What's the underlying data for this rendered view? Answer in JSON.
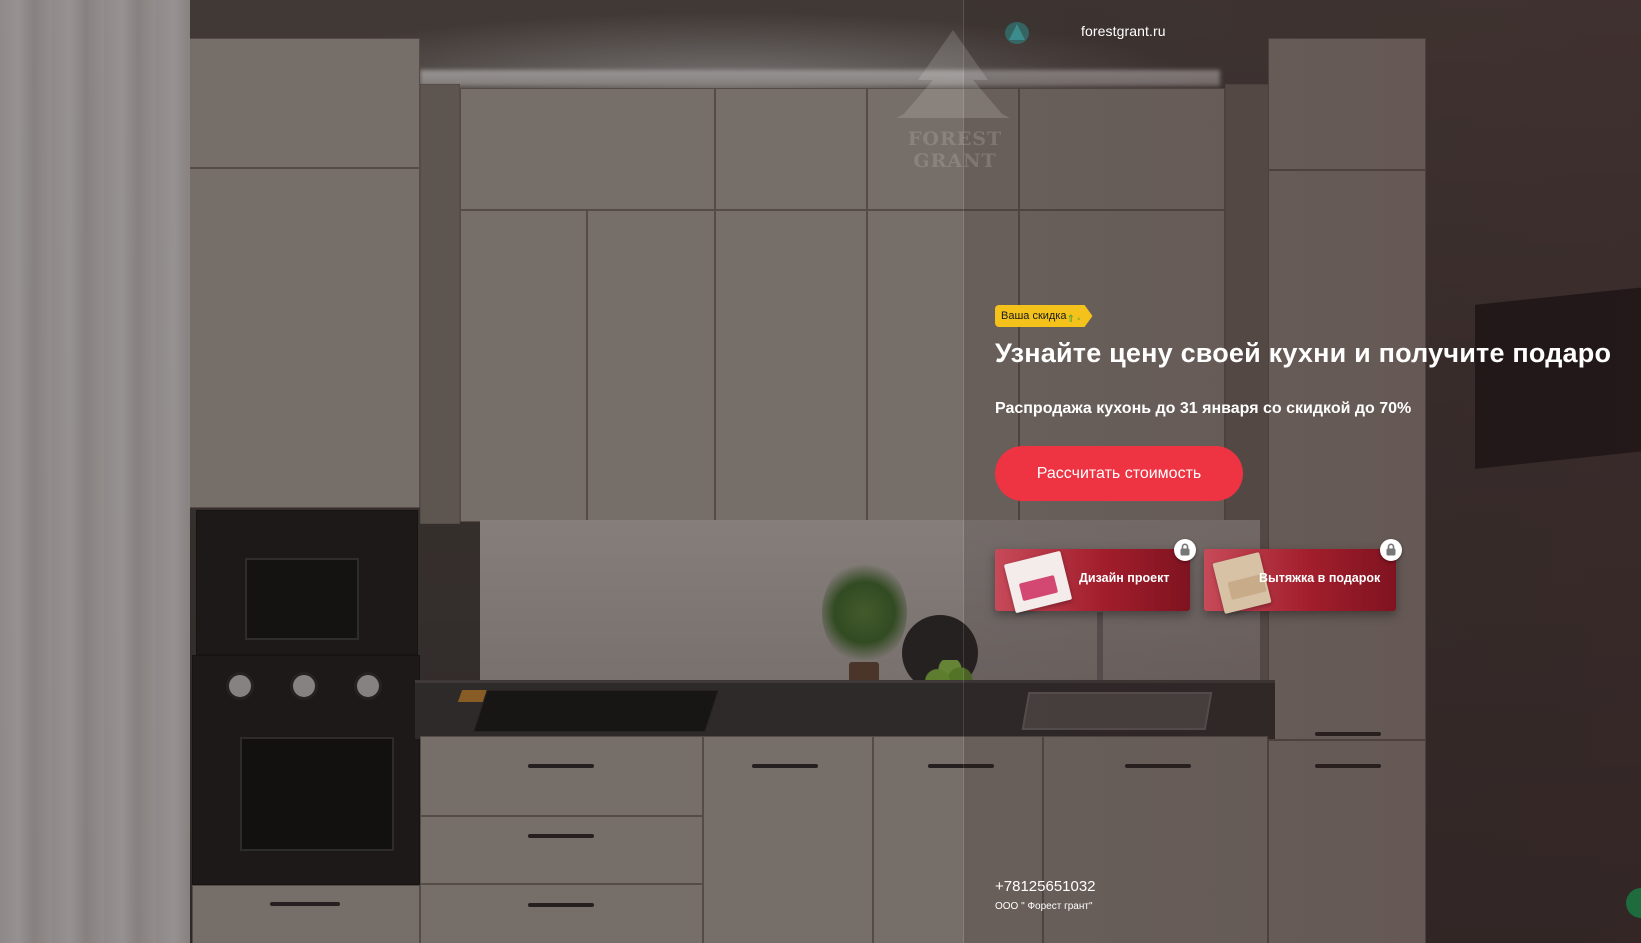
{
  "header": {
    "site_url": "forestgrant.ru",
    "site_icon": "brand-leaf-icon"
  },
  "watermark": {
    "brand": "FOREST GRANT"
  },
  "hero": {
    "badge_label": "Ваша скидка",
    "title": "Узнайте цену своей кухни и получите подаро",
    "subtitle": "Распродажа кухонь до 31 января со скидкой до 70%",
    "cta_label": "Рассчитать стоимость"
  },
  "gifts": [
    {
      "label": "Дизайн проект",
      "icon": "design-booklet-icon",
      "locked": true
    },
    {
      "label": "Вытяжка в подарок",
      "icon": "hood-gift-icon",
      "locked": true
    }
  ],
  "footer": {
    "phone": "+78125651032",
    "company": "ООО \" Форест грант\""
  },
  "colors": {
    "accent": "#ee3342",
    "badge": "#f4c21b",
    "gift_card": "#a21e2c"
  }
}
